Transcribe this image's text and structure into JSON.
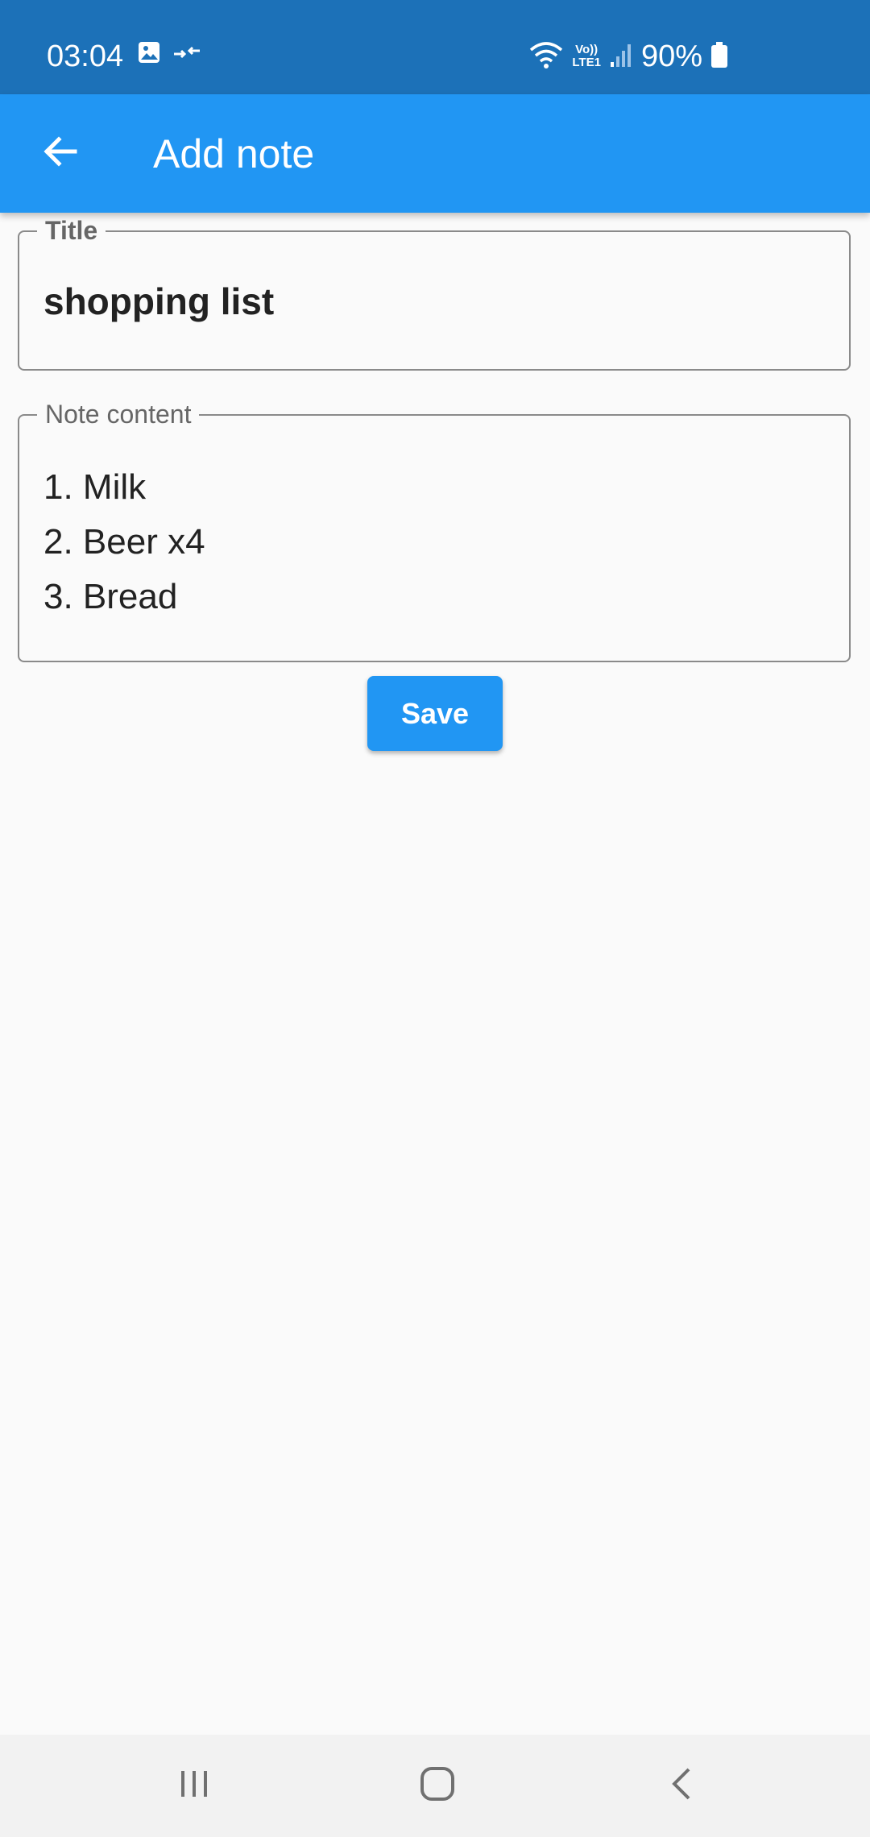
{
  "status_bar": {
    "time": "03:04",
    "battery": "90%",
    "network_top": "Vo))",
    "network_bottom": "LTE1",
    "icons": [
      "image-icon",
      "data-transfer-icon",
      "wifi-icon",
      "signal-icon",
      "battery-icon"
    ]
  },
  "app_bar": {
    "title": "Add note",
    "back_icon": "arrow-left-icon"
  },
  "form": {
    "title_label": "Title",
    "title_value": "shopping list",
    "content_label": "Note content",
    "content_lines": [
      "1. Milk",
      "2. Beer x4",
      "3. Bread"
    ],
    "save_label": "Save"
  },
  "nav_bar": {
    "icons": [
      "recent-apps-icon",
      "home-icon",
      "back-icon"
    ]
  },
  "colors": {
    "status_bar": "#1c71b8",
    "app_bar": "#2196f3",
    "button": "#2196f3",
    "background": "#fafafa"
  }
}
